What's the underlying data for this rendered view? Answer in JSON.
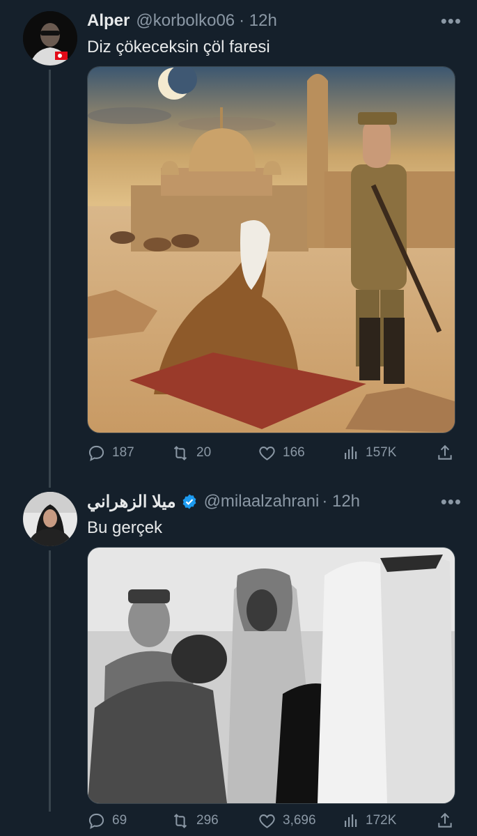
{
  "tweets": [
    {
      "name": "Alper",
      "handle": "@korbolko06",
      "time": "· 12h",
      "text": "Diz çökeceksin çöl faresi",
      "more": "•••",
      "stats": {
        "replies": "187",
        "retweets": "20",
        "likes": "166",
        "views": "157K"
      },
      "verified": false
    },
    {
      "name": "ميلا الزهراني",
      "handle": "@milaalzahrani",
      "time": "· 12h",
      "text": "Bu gerçek",
      "more": "•••",
      "stats": {
        "replies": "69",
        "retweets": "296",
        "likes": "3,696",
        "views": "172K"
      },
      "verified": true
    }
  ],
  "colors": {
    "background": "#15202b",
    "muted": "#8b98a5",
    "verified": "#1d9bf0",
    "thread_line": "#38444d"
  }
}
